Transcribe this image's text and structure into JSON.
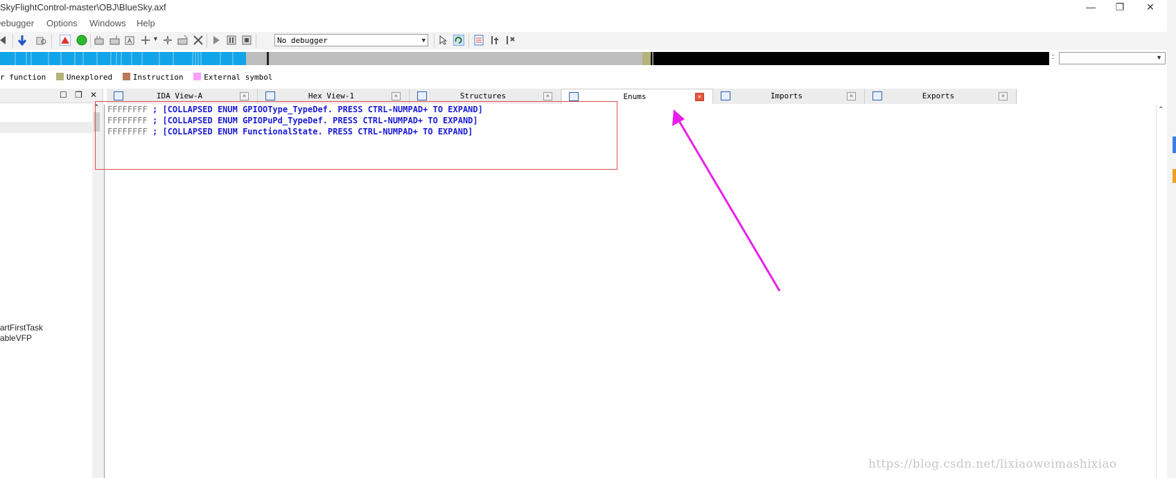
{
  "window": {
    "title": "SkyFlightControl-master\\OBJ\\BlueSky.axf",
    "minimize": "—",
    "restore": "❐",
    "close": "✕"
  },
  "menu": [
    "Debugger",
    "Options",
    "Windows",
    "Help"
  ],
  "toolbar": {
    "debugger_select": "No debugger"
  },
  "legend": {
    "items": [
      {
        "label": "function",
        "color": ""
      },
      {
        "label": "Unexplored",
        "color": "#b5b27a"
      },
      {
        "label": "Instruction",
        "color": "#b97a57"
      },
      {
        "label": "External symbol",
        "color": "#ff9fff"
      }
    ],
    "first_prefix": "r function"
  },
  "left_panel": {
    "items": [
      "artFirstTask",
      "ableVFP"
    ]
  },
  "tabs": [
    {
      "label": "IDA View-A",
      "active": false
    },
    {
      "label": "Hex View-1",
      "active": false
    },
    {
      "label": "Structures",
      "active": false
    },
    {
      "label": "Enums",
      "active": true
    },
    {
      "label": "Imports",
      "active": false
    },
    {
      "label": "Exports",
      "active": false
    }
  ],
  "enums": {
    "lines": [
      {
        "addr": "FFFFFFFF",
        "text": "; [COLLAPSED ENUM GPIOOType_TypeDef. PRESS CTRL-NUMPAD+ TO EXPAND]"
      },
      {
        "addr": "FFFFFFFF",
        "text": "; [COLLAPSED ENUM GPIOPuPd_TypeDef. PRESS CTRL-NUMPAD+ TO EXPAND]"
      },
      {
        "addr": "FFFFFFFF",
        "text": "; [COLLAPSED ENUM FunctionalState. PRESS CTRL-NUMPAD+ TO EXPAND]"
      }
    ]
  },
  "watermark": "https://blog.csdn.net/lixiaoweimashixiao",
  "colors": {
    "nav_code": "#12a4e8",
    "nav_gray": "#bdbdbd",
    "nav_data": "#000000",
    "nav_unexplored": "#b5b27a",
    "annotation_arrow": "#e81ee8",
    "highlight_box": "#e04a4a"
  }
}
